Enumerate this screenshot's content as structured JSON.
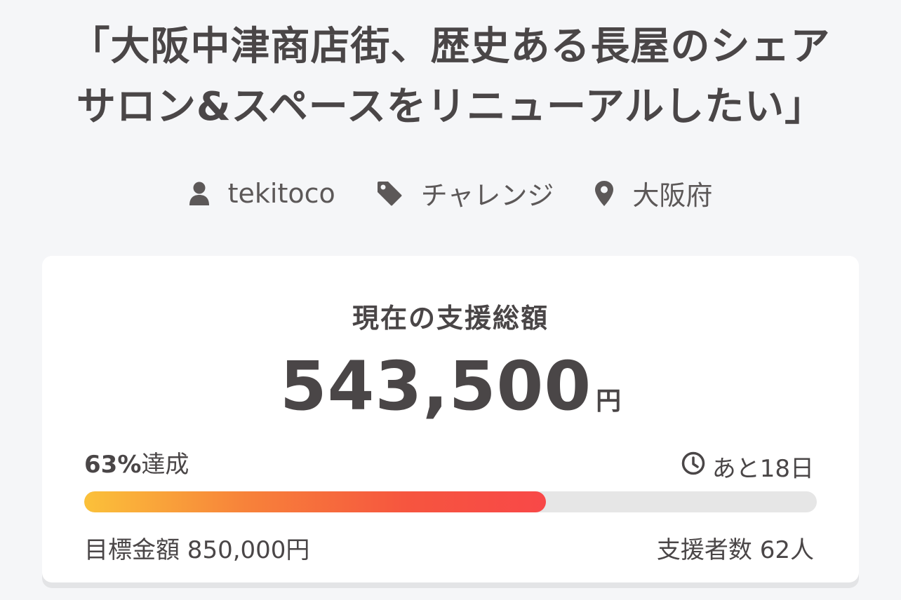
{
  "project": {
    "title_line1": "「大阪中津商店街、歴史ある長屋のシェア",
    "title_line2": "サロン&スペースをリニューアルしたい」"
  },
  "meta": {
    "owner": "tekitoco",
    "owner_icon": "user-icon",
    "category": "チャレンジ",
    "category_icon": "tag-icon",
    "location": "大阪府",
    "location_icon": "map-pin-icon"
  },
  "funding": {
    "label": "現在の支援総額",
    "amount": "543,500",
    "currency": "円",
    "percent_value": 63,
    "percent_text": "63%",
    "achieved_text": "達成",
    "clock_icon": "clock-icon",
    "remaining_text": "あと18日",
    "goal_text": "目標金額 850,000円",
    "supporters_text": "支援者数 62人"
  },
  "colors": {
    "background": "#f5f6f8",
    "text": "#4a4647",
    "progress_start": "#fbc13a",
    "progress_end": "#f84848",
    "progress_track": "#e6e6e6"
  }
}
